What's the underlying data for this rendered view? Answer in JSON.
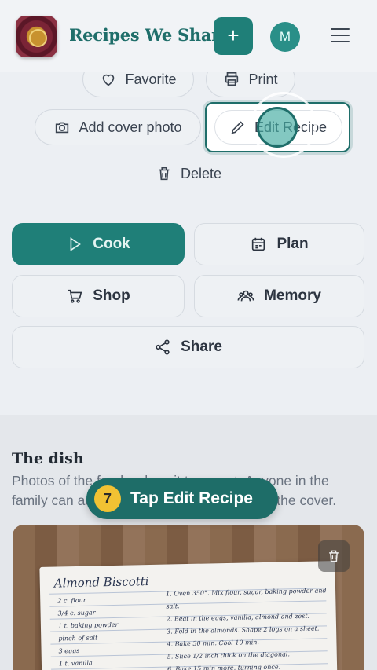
{
  "header": {
    "app_title": "Recipes We Share",
    "add_label": "+",
    "avatar_initial": "M"
  },
  "actions": {
    "favorite": "Favorite",
    "print": "Print",
    "add_cover": "Add cover photo",
    "edit_recipe": "Edit Recipe",
    "delete": "Delete"
  },
  "buttons": {
    "cook": "Cook",
    "plan": "Plan",
    "shop": "Shop",
    "memory": "Memory",
    "share": "Share"
  },
  "dish": {
    "title": "The dish",
    "description": "Photos of the food — how it turns out. Anyone in the family can add one. Tap a photo to set it as the cover."
  },
  "recipe_card": {
    "title": "Almond Biscotti",
    "ingredients": [
      "2 c. flour",
      "3/4 c. sugar",
      "1 t. baking powder",
      "pinch of salt",
      "3 eggs",
      "1 t. vanilla"
    ],
    "steps": [
      "1. Oven 350°. Mix flour, sugar, baking powder and salt.",
      "2. Beat in the eggs, vanilla, almond and zest.",
      "3. Fold in the almonds. Shape 2 logs on a sheet.",
      "4. Bake 30 min. Cool 10 min.",
      "5. Slice 1/2 inch thick on the diagonal.",
      "6. Bake 15 min more, turning once."
    ]
  },
  "tour": {
    "step_number": "7",
    "text": "Tap Edit Recipe"
  },
  "colors": {
    "accent": "#1f7f78",
    "tour_bg": "#1e6d68",
    "step_badge": "#f2c233"
  }
}
